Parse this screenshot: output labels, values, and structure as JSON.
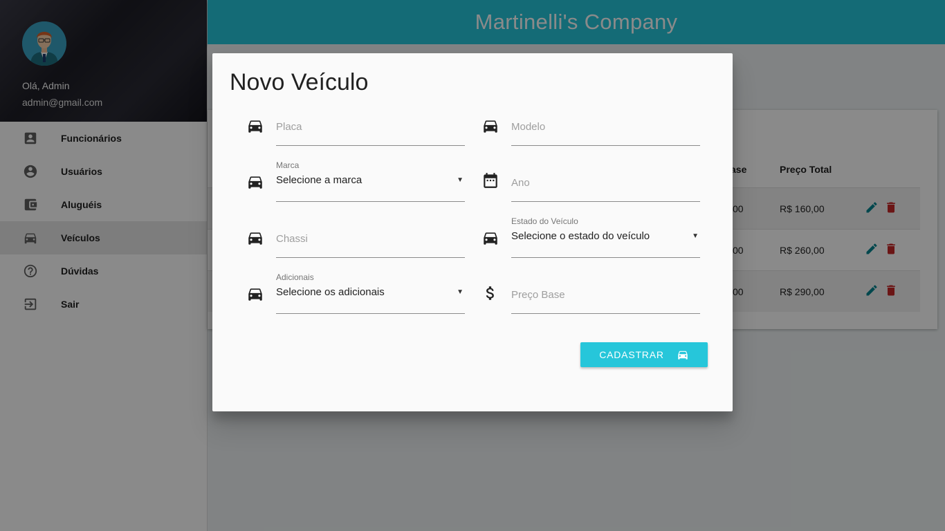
{
  "app": {
    "title": "Martinelli's Company",
    "header_color": "#26c6da"
  },
  "sidebar": {
    "greeting": "Olá, Admin",
    "email": "admin@gmail.com",
    "items": [
      {
        "label": "Funcionários",
        "icon": "contact-card-icon",
        "active": false
      },
      {
        "label": "Usuários",
        "icon": "account-circle-icon",
        "active": false
      },
      {
        "label": "Aluguéis",
        "icon": "wallet-icon",
        "active": false
      },
      {
        "label": "Veículos",
        "icon": "car-icon",
        "active": true
      },
      {
        "label": "Dúvidas",
        "icon": "help-circle-icon",
        "active": false
      },
      {
        "label": "Sair",
        "icon": "exit-icon",
        "active": false
      }
    ]
  },
  "table": {
    "headers": {
      "preco_base_partial": "ase",
      "preco_total": "Preço Total"
    },
    "rows": [
      {
        "preco_base_partial": "00",
        "preco_total": "R$ 160,00"
      },
      {
        "preco_base_partial": "00",
        "preco_total": "R$ 260,00"
      },
      {
        "preco_base_partial": "00",
        "preco_total": "R$ 290,00"
      }
    ],
    "edit_color": "#00838f",
    "delete_color": "#c62828"
  },
  "dialog": {
    "title": "Novo Veículo",
    "fields": {
      "placa": {
        "placeholder": "Placa",
        "icon": "car-icon"
      },
      "modelo": {
        "placeholder": "Modelo",
        "icon": "car-icon"
      },
      "marca": {
        "caption": "Marca",
        "value": "Selecione a marca",
        "icon": "car-icon"
      },
      "ano": {
        "placeholder": "Ano",
        "icon": "calendar-icon"
      },
      "chassi": {
        "placeholder": "Chassi",
        "icon": "car-icon"
      },
      "estado": {
        "caption": "Estado do Veículo",
        "value": "Selecione o estado do veículo",
        "icon": "car-icon"
      },
      "adicionais": {
        "caption": "Adicionais",
        "value": "Selecione os adicionais",
        "icon": "car-icon"
      },
      "preco_base": {
        "placeholder": "Preço Base",
        "icon": "dollar-icon"
      }
    },
    "submit_label": "CADASTRAR"
  }
}
